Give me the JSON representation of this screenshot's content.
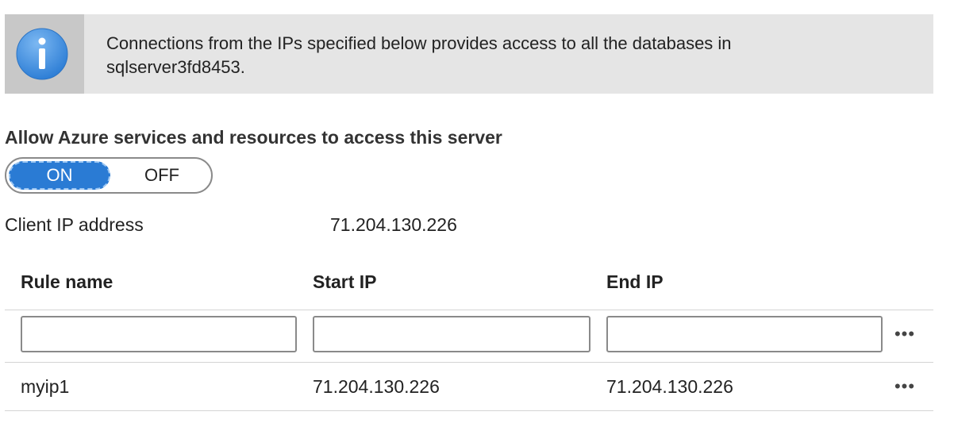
{
  "banner": {
    "icon": "info-icon",
    "text_line1": "Connections from the IPs specified below provides access to all the databases in",
    "text_line2": "sqlserver3fd8453."
  },
  "azure_access": {
    "label": "Allow Azure services and resources to access this server",
    "on_label": "ON",
    "off_label": "OFF",
    "selected": "ON"
  },
  "client_ip": {
    "label": "Client IP address",
    "value": "71.204.130.226"
  },
  "rules_table": {
    "columns": [
      "Rule name",
      "Start IP",
      "End IP"
    ],
    "new_row": {
      "rule_name": "",
      "start_ip": "",
      "end_ip": "",
      "more_label": "•••"
    },
    "rows": [
      {
        "rule_name": "myip1",
        "start_ip": "71.204.130.226",
        "end_ip": "71.204.130.226",
        "more_label": "•••"
      }
    ]
  },
  "colors": {
    "accent": "#2a7bd4",
    "banner_bg": "#e5e5e5",
    "info_icon": "#3f8fe0"
  }
}
